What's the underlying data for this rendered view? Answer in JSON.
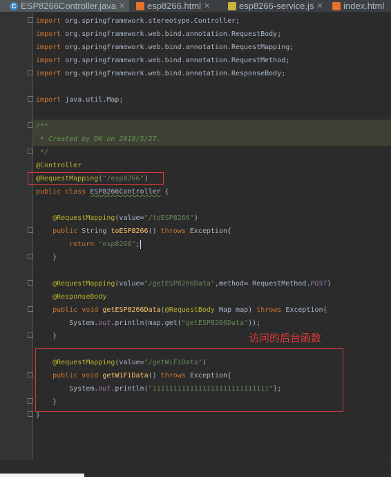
{
  "tabs": [
    {
      "name": "ESP8266Controller.java",
      "icon": "java-class-icon",
      "active": true
    },
    {
      "name": "esp8266.html",
      "icon": "html-file-icon",
      "active": false
    },
    {
      "name": "esp8266-service.js",
      "icon": "js-file-icon",
      "active": false
    },
    {
      "name": "index.html",
      "icon": "html-file-icon",
      "active": false
    }
  ],
  "code_lines": [
    "import org.springframework.stereotype.Controller;",
    "import org.springframework.web.bind.annotation.RequestBody;",
    "import org.springframework.web.bind.annotation.RequestMapping;",
    "import org.springframework.web.bind.annotation.RequestMethod;",
    "import org.springframework.web.bind.annotation.ResponseBody;",
    "",
    "import java.util.Map;",
    "",
    "/**",
    " * Created by DK on 2018/5/27.",
    " */",
    "@Controller",
    "@RequestMapping(\"/esp8266\")",
    "public class ESP8266Controller {",
    "",
    "    @RequestMapping(value=\"/toESP8266\")",
    "    public String toESP8266() throws Exception{",
    "        return \"esp8266\";",
    "    }",
    "",
    "    @RequestMapping(value=\"/getESP8266Data\",method= RequestMethod.POST)",
    "    @ResponseBody",
    "    public void getESP8266Data(@RequestBody Map map) throws Exception{",
    "        System.out.println(map.get(\"getESP8266Data\"));",
    "    }",
    "",
    "    @RequestMapping(value=\"/getWiFiData\")",
    "    public void getWiFiData() throws Exception{",
    "        System.out.println(\"1111111111111111111111111111\");",
    "    }",
    "}"
  ],
  "annotation_note": "访问的后台函数",
  "colors": {
    "keyword": "#cc7832",
    "annotation": "#bbb529",
    "string": "#6a8759",
    "comment": "#629755",
    "method": "#ffc66d",
    "highlight_box": "#e2393b",
    "background": "#2b2b2b"
  }
}
